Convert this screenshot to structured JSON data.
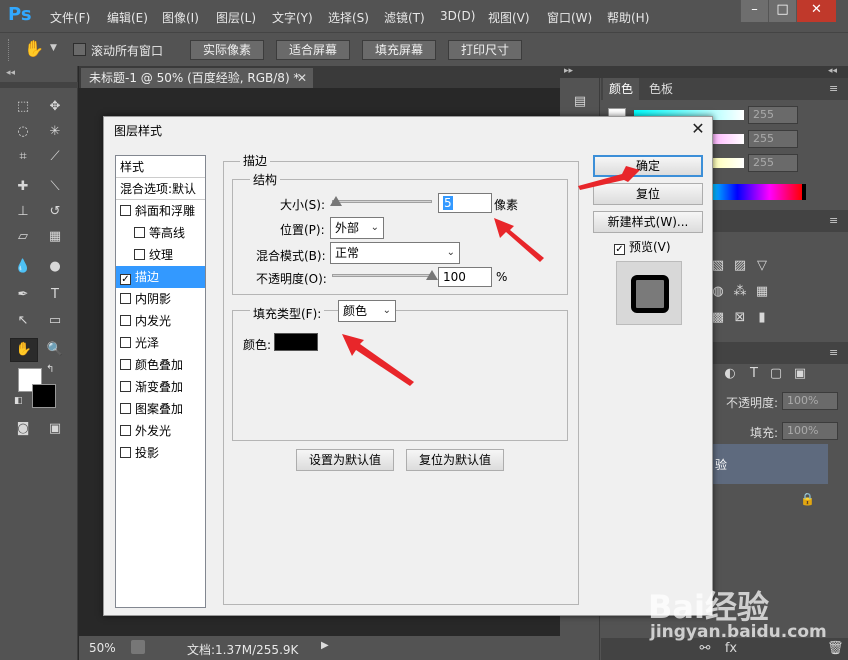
{
  "app": {
    "logo": "Ps",
    "menus": [
      "文件(F)",
      "编辑(E)",
      "图像(I)",
      "图层(L)",
      "文字(Y)",
      "选择(S)",
      "滤镜(T)",
      "3D(D)",
      "视图(V)",
      "窗口(W)",
      "帮助(H)"
    ]
  },
  "options": {
    "scroll_all_label": "滚动所有窗口",
    "buttons": [
      "实际像素",
      "适合屏幕",
      "填充屏幕",
      "打印尺寸"
    ]
  },
  "document": {
    "tab_title": "未标题-1 @ 50% (百度经验, RGB/8) *",
    "zoom": "50%",
    "doc_info": "文档:1.37M/255.9K"
  },
  "right_panel": {
    "tabs": [
      "颜色",
      "色板"
    ],
    "color_values": [
      "255",
      "255",
      "255"
    ],
    "opacity_label": "不透明度:",
    "opacity_value": "100%",
    "fill_label": "填充:",
    "fill_value": "100%",
    "layer_name_fragment": "验"
  },
  "dialog": {
    "title": "图层样式",
    "styles_header": "样式",
    "blend_options": "混合选项:默认",
    "style_items": [
      {
        "label": "斜面和浮雕",
        "checked": false,
        "indent": false
      },
      {
        "label": "等高线",
        "checked": false,
        "indent": true
      },
      {
        "label": "纹理",
        "checked": false,
        "indent": true
      },
      {
        "label": "描边",
        "checked": true,
        "indent": false,
        "selected": true
      },
      {
        "label": "内阴影",
        "checked": false,
        "indent": false
      },
      {
        "label": "内发光",
        "checked": false,
        "indent": false
      },
      {
        "label": "光泽",
        "checked": false,
        "indent": false
      },
      {
        "label": "颜色叠加",
        "checked": false,
        "indent": false
      },
      {
        "label": "渐变叠加",
        "checked": false,
        "indent": false
      },
      {
        "label": "图案叠加",
        "checked": false,
        "indent": false
      },
      {
        "label": "外发光",
        "checked": false,
        "indent": false
      },
      {
        "label": "投影",
        "checked": false,
        "indent": false
      }
    ],
    "stroke": {
      "section_title": "描边",
      "structure_title": "结构",
      "size_label": "大小(S):",
      "size_value": "5",
      "size_unit": "像素",
      "position_label": "位置(P):",
      "position_value": "外部",
      "blend_mode_label": "混合模式(B):",
      "blend_mode_value": "正常",
      "opacity_label": "不透明度(O):",
      "opacity_value": "100",
      "opacity_unit": "%",
      "fill_type_label": "填充类型(F):",
      "fill_type_value": "颜色",
      "color_label": "颜色:",
      "color_value": "#000000"
    },
    "buttons": {
      "ok": "确定",
      "reset": "复位",
      "new_style": "新建样式(W)...",
      "preview": "预览(V)",
      "set_default": "设置为默认值",
      "reset_default": "复位为默认值"
    },
    "preview_checked": true
  },
  "watermark": {
    "logo": "Bai经验",
    "url": "jingyan.baidu.com"
  },
  "colors": {
    "accent": "#3399ff",
    "annotation_arrow": "#e8262a",
    "ps_blue": "#31a8ff"
  }
}
